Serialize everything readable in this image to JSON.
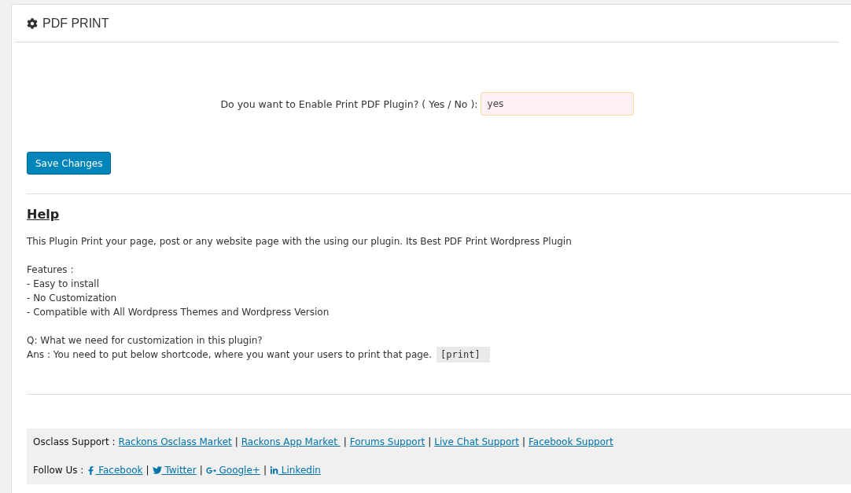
{
  "header": {
    "title": "PDF PRINT"
  },
  "setting": {
    "label": "Do you want to Enable Print PDF Plugin? ( Yes / No ):",
    "value": "yes"
  },
  "save_button": "Save Changes",
  "help": {
    "title": "Help",
    "intro": "This Plugin Print your page, post or any website page with the using our plugin. Its Best PDF Print Wordpress Plugin",
    "features_heading": "Features :",
    "features": [
      "- Easy to install",
      "- No Customization",
      "- Compatible with All Wordpress Themes and Wordpress Version"
    ],
    "question": "Q: What we need for customization in this plugin?",
    "answer": "Ans : You need to put below shortcode, where you want your users to print that page.",
    "shortcode": "[print]"
  },
  "footer": {
    "support": {
      "label": "Osclass Support :",
      "items": [
        {
          "kind": "link",
          "label": "Rackons Osclass Market"
        },
        {
          "kind": "separator",
          "text": "|"
        },
        {
          "kind": "link",
          "label": "Rackons App Market "
        },
        {
          "kind": "separator",
          "text": "|"
        },
        {
          "kind": "link",
          "label": "Forums Support"
        },
        {
          "kind": "separator",
          "text": "|"
        },
        {
          "kind": "link",
          "label": "Live Chat Support"
        },
        {
          "kind": "separator",
          "text": "|"
        },
        {
          "kind": "link",
          "label": "Facebook Support"
        }
      ]
    },
    "follow": {
      "label": "Follow Us :",
      "items": [
        {
          "kind": "facebook",
          "label": " Facebook"
        },
        {
          "kind": "separator",
          "text": "|"
        },
        {
          "kind": "twitter",
          "label": " Twitter"
        },
        {
          "kind": "separator",
          "text": "|"
        },
        {
          "kind": "googleplus",
          "label": " Google+"
        },
        {
          "kind": "separator",
          "text": "|"
        },
        {
          "kind": "linkedin",
          "label": " Linkedin"
        }
      ]
    }
  }
}
